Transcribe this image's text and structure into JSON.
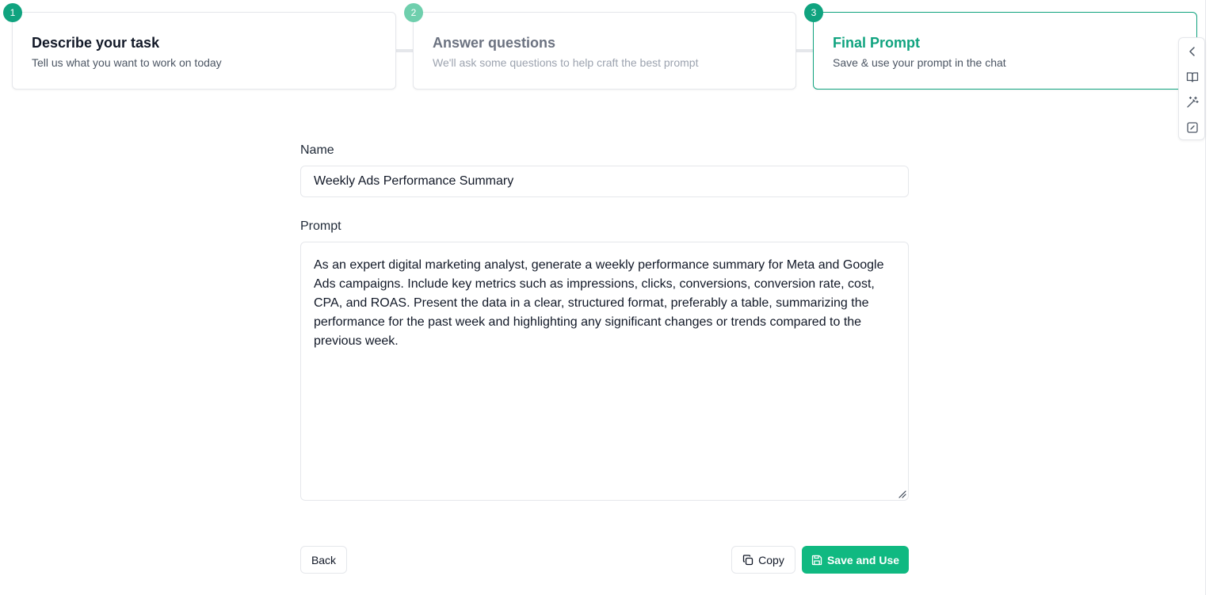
{
  "stepper": {
    "steps": [
      {
        "number": "1",
        "title": "Describe your task",
        "description": "Tell us what you want to work on today",
        "state": "done"
      },
      {
        "number": "2",
        "title": "Answer questions",
        "description": "We'll ask some questions to help craft the best prompt",
        "state": "done"
      },
      {
        "number": "3",
        "title": "Final Prompt",
        "description": "Save & use your prompt in the chat",
        "state": "active"
      }
    ]
  },
  "side_rail": {
    "icons": [
      "chevron-left-icon",
      "book-open-icon",
      "magic-wand-icon",
      "edit-square-icon"
    ]
  },
  "form": {
    "name_label": "Name",
    "name_value": "Weekly Ads Performance Summary",
    "prompt_label": "Prompt",
    "prompt_value": "As an expert digital marketing analyst, generate a weekly performance summary for Meta and Google Ads campaigns. Include key metrics such as impressions, clicks, conversions, conversion rate, cost, CPA, and ROAS. Present the data in a clear, structured format, preferably a table, summarizing the performance for the past week and highlighting any significant changes or trends compared to the previous week."
  },
  "actions": {
    "back_label": "Back",
    "copy_label": "Copy",
    "save_label": "Save and Use"
  },
  "colors": {
    "accent": "#10a37f",
    "primary_button": "#10b981",
    "border": "#e5e7eb"
  }
}
